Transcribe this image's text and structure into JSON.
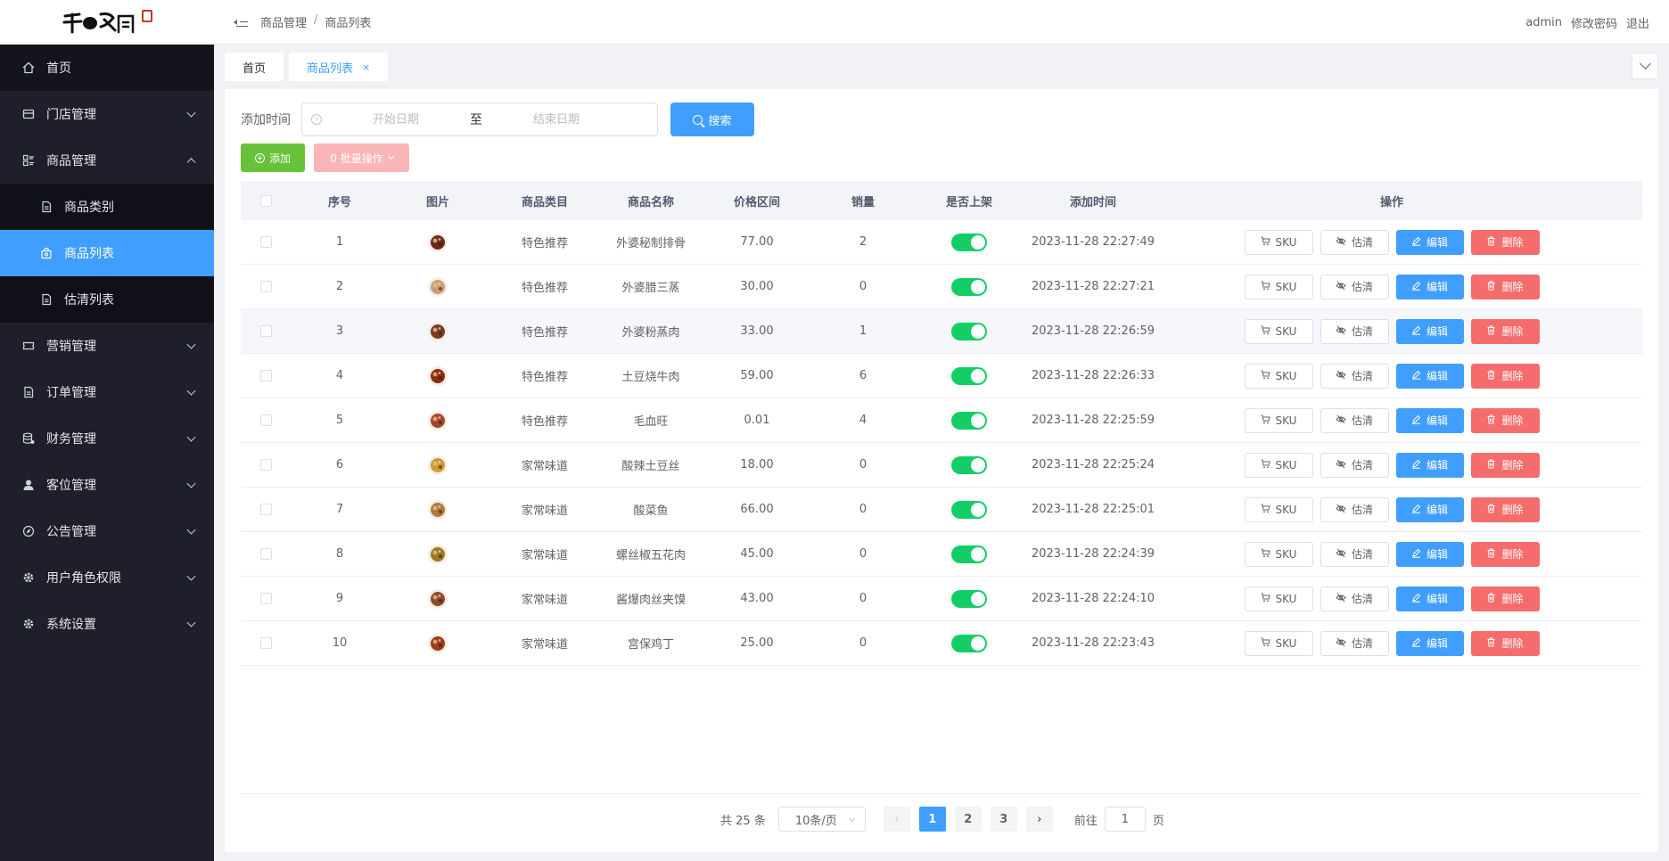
{
  "logo": {
    "text": "千"
  },
  "sidebar": {
    "items": [
      {
        "label": "首页",
        "icon": "home-icon"
      },
      {
        "label": "门店管理",
        "icon": "store-icon"
      },
      {
        "label": "商品管理",
        "icon": "grid-icon",
        "expanded": true
      },
      {
        "label": "营销管理",
        "icon": "ticket-icon"
      },
      {
        "label": "订单管理",
        "icon": "document-icon"
      },
      {
        "label": "财务管理",
        "icon": "database-icon"
      },
      {
        "label": "客位管理",
        "icon": "user-icon"
      },
      {
        "label": "公告管理",
        "icon": "compass-icon"
      },
      {
        "label": "用户角色权限",
        "icon": "gear-icon"
      },
      {
        "label": "系统设置",
        "icon": "gear-icon"
      }
    ],
    "submenu": [
      {
        "label": "商品类别",
        "icon": "document-icon"
      },
      {
        "label": "商品列表",
        "icon": "bag-icon",
        "active": true
      },
      {
        "label": "估清列表",
        "icon": "document-icon"
      }
    ]
  },
  "header": {
    "breadcrumb": [
      "商品管理",
      "/",
      "商品列表"
    ],
    "user": "admin",
    "change_password": "修改密码",
    "logout": "退出"
  },
  "tabs": [
    {
      "label": "首页"
    },
    {
      "label": "商品列表",
      "close": "×"
    }
  ],
  "filter": {
    "label": "添加时间",
    "start_placeholder": "开始日期",
    "separator": "至",
    "end_placeholder": "结束日期",
    "search_label": "搜索"
  },
  "actions": {
    "add_label": "添加",
    "batch_label": "0 批量操作"
  },
  "table": {
    "columns": [
      "序号",
      "图片",
      "商品类目",
      "商品名称",
      "价格区间",
      "销量",
      "是否上架",
      "添加时间",
      "操作"
    ],
    "op_labels": {
      "sku": "SKU",
      "estimate": "估清",
      "edit": "编辑",
      "delete": "删除"
    },
    "rows": [
      {
        "idx": "1",
        "cat": "特色推荐",
        "name": "外婆秘制排骨",
        "price": "77.00",
        "sales": "2",
        "on_shelf": true,
        "time": "2023-11-28 22:27:49"
      },
      {
        "idx": "2",
        "cat": "特色推荐",
        "name": "外婆腊三蒸",
        "price": "30.00",
        "sales": "0",
        "on_shelf": true,
        "time": "2023-11-28 22:27:21"
      },
      {
        "idx": "3",
        "cat": "特色推荐",
        "name": "外婆粉蒸肉",
        "price": "33.00",
        "sales": "1",
        "on_shelf": true,
        "time": "2023-11-28 22:26:59"
      },
      {
        "idx": "4",
        "cat": "特色推荐",
        "name": "土豆烧牛肉",
        "price": "59.00",
        "sales": "6",
        "on_shelf": true,
        "time": "2023-11-28 22:26:33"
      },
      {
        "idx": "5",
        "cat": "特色推荐",
        "name": "毛血旺",
        "price": "0.01",
        "sales": "4",
        "on_shelf": true,
        "time": "2023-11-28 22:25:59"
      },
      {
        "idx": "6",
        "cat": "家常味道",
        "name": "酸辣土豆丝",
        "price": "18.00",
        "sales": "0",
        "on_shelf": true,
        "time": "2023-11-28 22:25:24"
      },
      {
        "idx": "7",
        "cat": "家常味道",
        "name": "酸菜鱼",
        "price": "66.00",
        "sales": "0",
        "on_shelf": true,
        "time": "2023-11-28 22:25:01"
      },
      {
        "idx": "8",
        "cat": "家常味道",
        "name": "螺丝椒五花肉",
        "price": "45.00",
        "sales": "0",
        "on_shelf": true,
        "time": "2023-11-28 22:24:39"
      },
      {
        "idx": "9",
        "cat": "家常味道",
        "name": "酱爆肉丝夹馍",
        "price": "43.00",
        "sales": "0",
        "on_shelf": true,
        "time": "2023-11-28 22:24:10"
      },
      {
        "idx": "10",
        "cat": "家常味道",
        "name": "宫保鸡丁",
        "price": "25.00",
        "sales": "0",
        "on_shelf": true,
        "time": "2023-11-28 22:23:43"
      }
    ]
  },
  "pagination": {
    "total": "共 25 条",
    "page_size": "10条/页",
    "pages": [
      "1",
      "2",
      "3"
    ],
    "current": "1",
    "jump_prefix": "前往",
    "jump_value": "1",
    "jump_suffix": "页"
  },
  "colors": {
    "primary": "#409eff",
    "success": "#67c23a",
    "danger": "#f56c6c",
    "switch_on": "#13ce66",
    "sidebar_bg": "#1f1f2b"
  }
}
